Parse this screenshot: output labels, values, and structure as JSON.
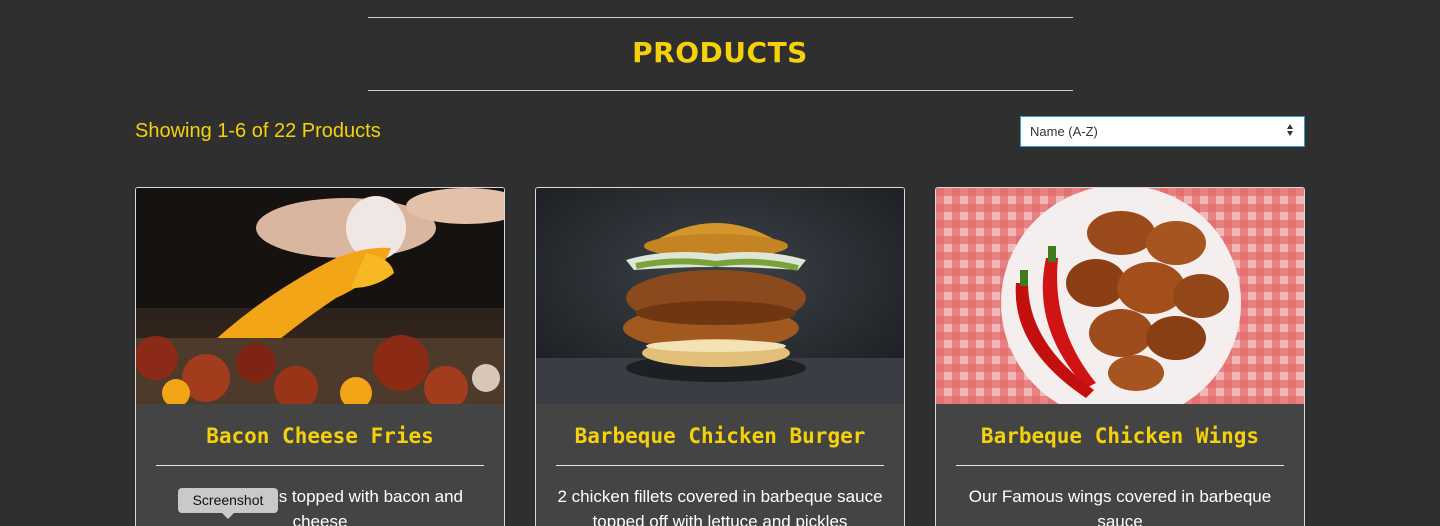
{
  "header": {
    "title": "PRODUCTS"
  },
  "toolbar": {
    "results_text": "Showing 1-6 of 22 Products",
    "sort_selected": "Name (A-Z)"
  },
  "products": [
    {
      "name": "Bacon Cheese Fries",
      "description": "Crispy fries topped with bacon and cheese",
      "description_visible": "C",
      "description_visible_2": "es topped with bacon and",
      "description_line_2": "cheese",
      "image": "bacon-cheese-fries-photo"
    },
    {
      "name": "Barbeque Chicken Burger",
      "description_line_1": "2 chicken fillets covered in barbeque sauce",
      "description_line_2": "topped off with lettuce and pickles",
      "image": "chicken-burger-photo"
    },
    {
      "name": "Barbeque Chicken Wings",
      "description_line_1": "Our Famous wings covered in barbeque",
      "description_line_2": "sauce",
      "image": "chicken-wings-photo"
    }
  ],
  "tooltip": {
    "label": "Screenshot"
  },
  "colors": {
    "accent": "#f4d10a",
    "background": "#2f2f2f",
    "card": "#444444",
    "select_border": "#2a9fd6"
  }
}
